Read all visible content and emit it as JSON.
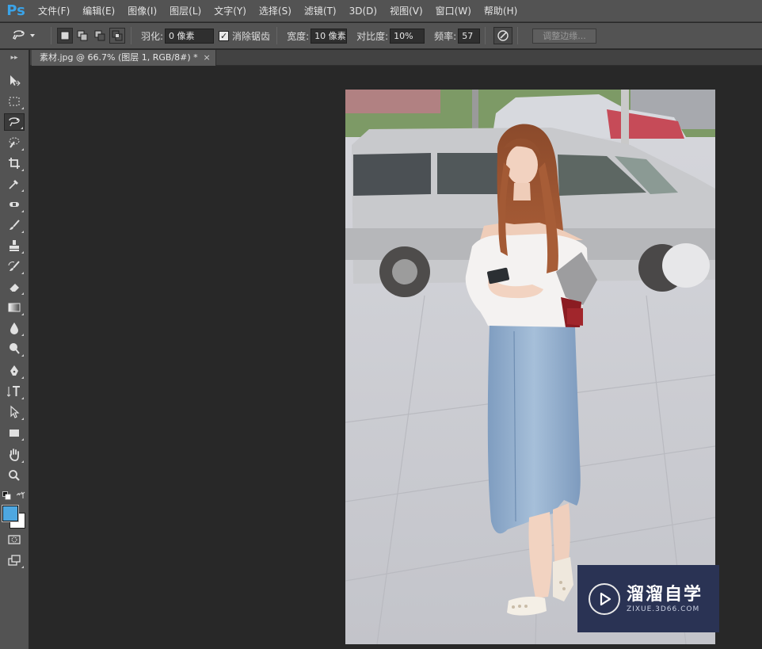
{
  "app": {
    "logo": "Ps"
  },
  "menu": [
    "文件(F)",
    "编辑(E)",
    "图像(I)",
    "图层(L)",
    "文字(Y)",
    "选择(S)",
    "滤镜(T)",
    "3D(D)",
    "视图(V)",
    "窗口(W)",
    "帮助(H)"
  ],
  "options": {
    "feather_label": "羽化:",
    "feather_value": "0 像素",
    "antialias_label": "消除锯齿",
    "antialias_checked": true,
    "width_label": "宽度:",
    "width_value": "10 像素",
    "contrast_label": "对比度:",
    "contrast_value": "10%",
    "frequency_label": "频率:",
    "frequency_value": "57",
    "refine_edge_label": "调整边缘..."
  },
  "toolbar": {
    "collapse_glyph": "▸▸"
  },
  "tab": {
    "title": "素材.jpg @ 66.7% (图层 1, RGB/8#) *",
    "close": "×"
  },
  "colors": {
    "foreground": "#4ea7e0",
    "background": "#ffffff",
    "accent": "#3aa3e8"
  },
  "watermark": {
    "title": "溜溜自学",
    "url": "ZIXUE.3D66.COM"
  }
}
